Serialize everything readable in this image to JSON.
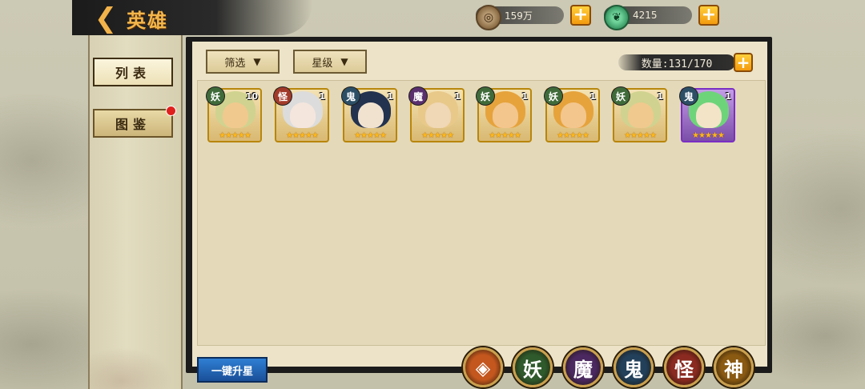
{
  "header": {
    "back_icon": "chevron-left-icon",
    "title": "英雄"
  },
  "currencies": [
    {
      "name": "coin",
      "icon": "coin-icon",
      "value": "159万"
    },
    {
      "name": "jade",
      "icon": "jade-icon",
      "value": "4215"
    }
  ],
  "sidebar": {
    "items": [
      {
        "label": "列表",
        "active": true
      },
      {
        "label": "图鉴",
        "notification": true
      }
    ]
  },
  "filters": {
    "filter_label": "筛选",
    "star_label": "星级"
  },
  "count": {
    "label": "数量:131/170"
  },
  "heroes": [
    {
      "faction": "妖",
      "faction_color": "#3f6b3a",
      "level": "10",
      "stars": "★★★★★",
      "face_color": "#f0c98e",
      "hair_color": "#cfd38f",
      "frame": "gold"
    },
    {
      "faction": "怪",
      "faction_color": "#a23a2a",
      "level": "1",
      "stars": "★★★★★",
      "face_color": "#f4e6dd",
      "hair_color": "#dcdcdc",
      "frame": "gold"
    },
    {
      "faction": "鬼",
      "faction_color": "#2c4f66",
      "level": "1",
      "stars": "★★★★★",
      "face_color": "#f1e2d0",
      "hair_color": "#23324f",
      "frame": "gold"
    },
    {
      "faction": "魔",
      "faction_color": "#5a2f6e",
      "level": "1",
      "stars": "★★★★★",
      "face_color": "#f0d7b5",
      "hair_color": "#e8c98a",
      "frame": "gold"
    },
    {
      "faction": "妖",
      "faction_color": "#3f6b3a",
      "level": "1",
      "stars": "★★★★★",
      "face_color": "#f3c68e",
      "hair_color": "#e6a33c",
      "frame": "gold"
    },
    {
      "faction": "妖",
      "faction_color": "#3f6b3a",
      "level": "1",
      "stars": "★★★★★",
      "face_color": "#f3c68e",
      "hair_color": "#e6a33c",
      "frame": "gold"
    },
    {
      "faction": "妖",
      "faction_color": "#3f6b3a",
      "level": "1",
      "stars": "★★★★★",
      "face_color": "#f0c98e",
      "hair_color": "#cfd38f",
      "frame": "gold"
    },
    {
      "faction": "鬼",
      "faction_color": "#2c4f66",
      "level": "1",
      "stars": "★★★★★",
      "face_color": "#f3e4c8",
      "hair_color": "#6ed47a",
      "frame": "purple"
    }
  ],
  "bottom": {
    "upgrade_label": "一键升星",
    "faction_filters": [
      {
        "label": "all-factions-icon",
        "color": "#c4571e"
      },
      {
        "label": "妖",
        "color": "#2f5a2c"
      },
      {
        "label": "魔",
        "color": "#4b2860"
      },
      {
        "label": "鬼",
        "color": "#22405a"
      },
      {
        "label": "怪",
        "color": "#8a2a20"
      },
      {
        "label": "神",
        "color": "#8a5a12"
      }
    ]
  }
}
